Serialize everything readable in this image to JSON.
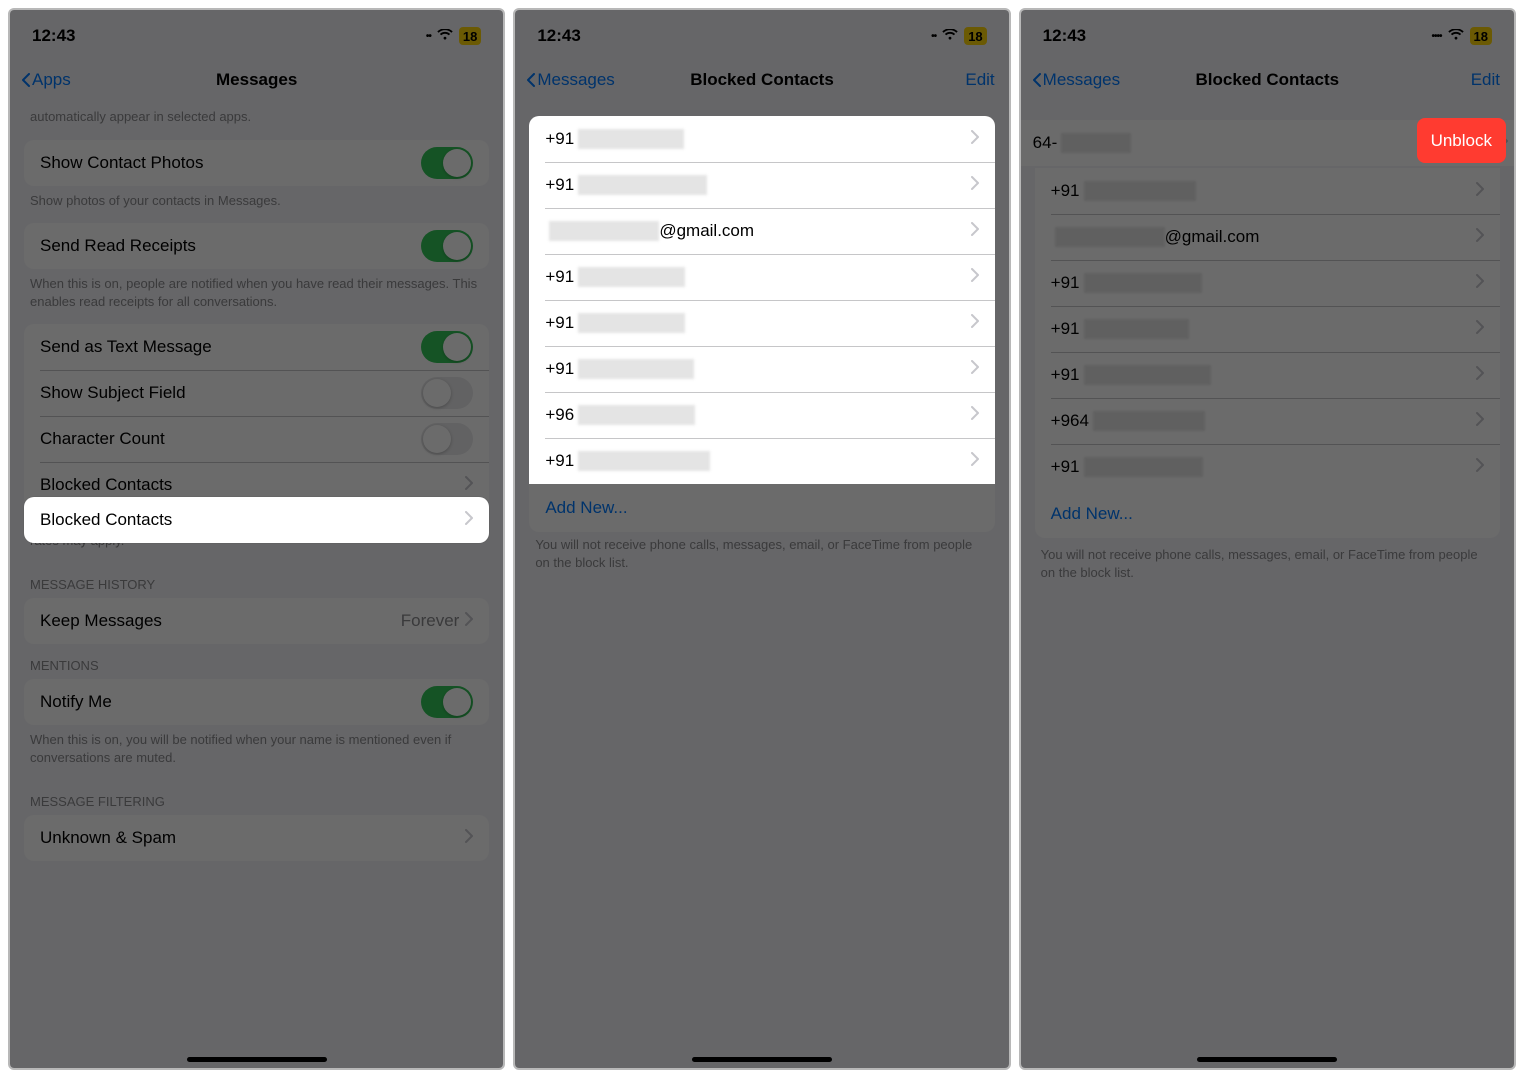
{
  "status": {
    "time": "12:43",
    "battery": "18"
  },
  "panel1": {
    "nav_back": "Apps",
    "nav_title": "Messages",
    "intro_footer": "automatically appear in selected apps.",
    "show_contact_photos": {
      "label": "Show Contact Photos",
      "footer": "Show photos of your contacts in Messages."
    },
    "read_receipts": {
      "label": "Send Read Receipts",
      "footer": "When this is on, people are notified when you have read their messages. This enables read receipts for all conversations."
    },
    "send_as_text": "Send as Text Message",
    "show_subject": "Show Subject Field",
    "char_count": "Character Count",
    "blocked_contacts": "Blocked Contacts",
    "blocked_footer": "Send as Text Message when iMessage is unavailable. Carrier messaging rates may apply.",
    "history_header": "MESSAGE HISTORY",
    "keep_messages": {
      "label": "Keep Messages",
      "value": "Forever"
    },
    "mentions_header": "MENTIONS",
    "notify_me": {
      "label": "Notify Me",
      "footer": "When this is on, you will be notified when your name is mentioned even if conversations are muted."
    },
    "filtering_header": "MESSAGE FILTERING",
    "unknown_spam": "Unknown & Spam"
  },
  "panel2": {
    "nav_back": "Messages",
    "nav_title": "Blocked Contacts",
    "nav_edit": "Edit",
    "rows": [
      {
        "prefix": "+91",
        "suffix": ""
      },
      {
        "prefix": "+91",
        "suffix": ""
      },
      {
        "prefix": "",
        "suffix": "@gmail.com"
      },
      {
        "prefix": "+91",
        "suffix": ""
      },
      {
        "prefix": "+91",
        "suffix": ""
      },
      {
        "prefix": "+91",
        "suffix": ""
      },
      {
        "prefix": "+96",
        "suffix": ""
      },
      {
        "prefix": "+91",
        "suffix": ""
      }
    ],
    "add_new": "Add New...",
    "footer": "You will not receive phone calls, messages, email, or FaceTime from people on the block list."
  },
  "panel3": {
    "nav_back": "Messages",
    "nav_title": "Blocked Contacts",
    "nav_edit": "Edit",
    "swiped_visible": "64-",
    "unblock": "Unblock",
    "rows": [
      {
        "prefix": "+91",
        "suffix": ""
      },
      {
        "prefix": "",
        "suffix": "@gmail.com"
      },
      {
        "prefix": "+91",
        "suffix": ""
      },
      {
        "prefix": "+91",
        "suffix": ""
      },
      {
        "prefix": "+91",
        "suffix": ""
      },
      {
        "prefix": "+964",
        "suffix": ""
      },
      {
        "prefix": "+91",
        "suffix": ""
      }
    ],
    "add_new": "Add New...",
    "footer": "You will not receive phone calls, messages, email, or FaceTime from people on the block list."
  }
}
